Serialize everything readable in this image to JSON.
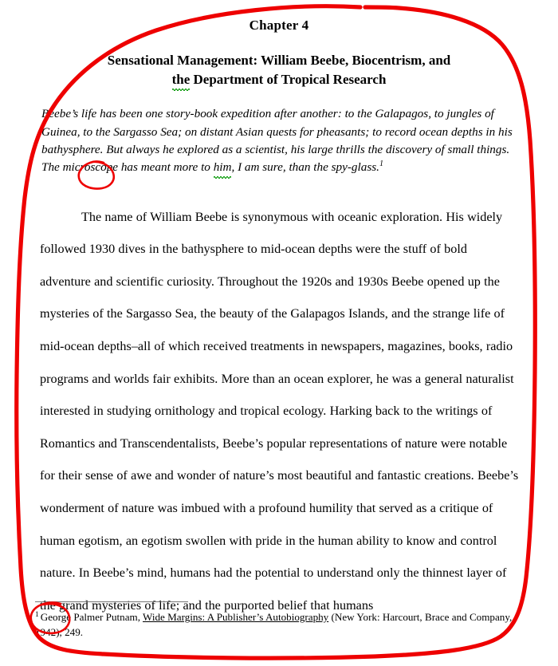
{
  "document": {
    "chapter_label": "Chapter 4",
    "title_line_1_before": "Sensational Management:   William Beebe, Biocentrism, and",
    "title_line_2_grammar_word": "the",
    "title_line_2_rest": " Department of Tropical Research",
    "epigraph": {
      "text_before_grammar": "Beebe’s life has been one story-book expedition after another: to the Galapagos, to jungles of Guinea, to the Sargasso Sea; on distant Asian quests for pheasants; to record ocean depths in his bathysphere.  But always he explored as a scientist, his large thrills the discovery of small things.  The microscope has meant more to ",
      "grammar_word": "him",
      "text_after_grammar": ", I am sure, than the spy-glass.",
      "footnote_ref": "1"
    },
    "body_paragraph": "The name of William Beebe is synonymous with oceanic exploration.  His widely followed 1930 dives in the bathysphere to mid-ocean depths were the stuff of bold adventure and scientific curiosity.  Throughout the 1920s and 1930s Beebe opened up the mysteries of the Sargasso Sea, the beauty of the Galapagos Islands, and the strange life of mid-ocean depths–all of which received treatments in newspapers, magazines, books, radio programs and worlds fair exhibits.  More than an ocean explorer, he was a general naturalist interested in studying ornithology and tropical ecology.  Harking back to the writings of Romantics and Transcendentalists, Beebe’s popular representations of nature were notable for their sense of awe and wonder of nature’s most beautiful and fantastic creations.  Beebe’s wonderment of nature was imbued with a profound humility that served as a critique of human egotism, an egotism swollen with pride in the human ability to know and control nature.  In Beebe’s mind, humans had the potential to understand only the thinnest layer of the grand mysteries of life; and the purported belief that humans",
    "footnote": {
      "number": "1",
      "author": "George Palmer Putnam, ",
      "book_title": "Wide Margins: A Publisher’s Autobiography",
      "publication": " (New York: Harcourt, Brace and Company, 1942), 249."
    }
  },
  "annotation": {
    "stroke_color": "#ee0000",
    "ellipse_note": "hand-drawn red loop enclosing the page plus a small red circle around the epigraph footnote marker"
  }
}
